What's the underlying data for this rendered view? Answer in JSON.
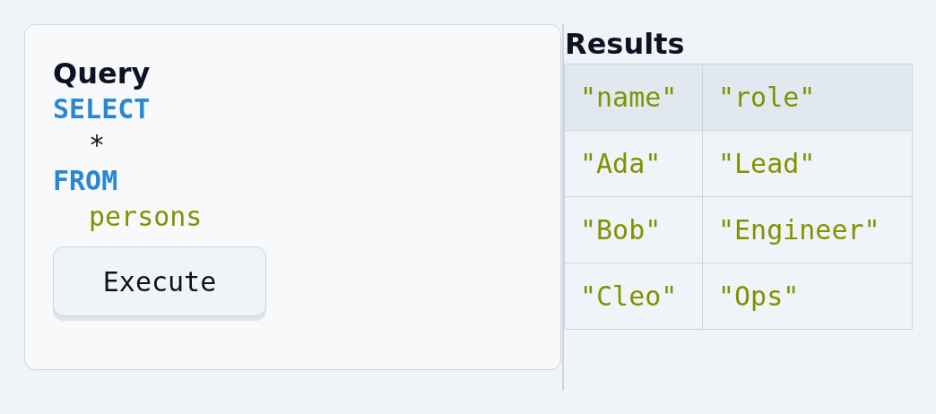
{
  "query_panel": {
    "title": "Query",
    "code_lines": [
      {
        "text": "SELECT",
        "kind": "keyword"
      },
      {
        "text": "*",
        "kind": "operator"
      },
      {
        "text": "FROM",
        "kind": "keyword"
      },
      {
        "text": "persons",
        "kind": "identifier"
      }
    ],
    "button": "Execute"
  },
  "results": {
    "title": "Results",
    "columns": [
      "\"name\"",
      "\"role\""
    ],
    "rows": [
      [
        "\"Ada\"",
        "\"Lead\""
      ],
      [
        "\"Bob\"",
        "\"Engineer\""
      ],
      [
        "\"Cleo\"",
        "\"Ops\""
      ]
    ]
  }
}
